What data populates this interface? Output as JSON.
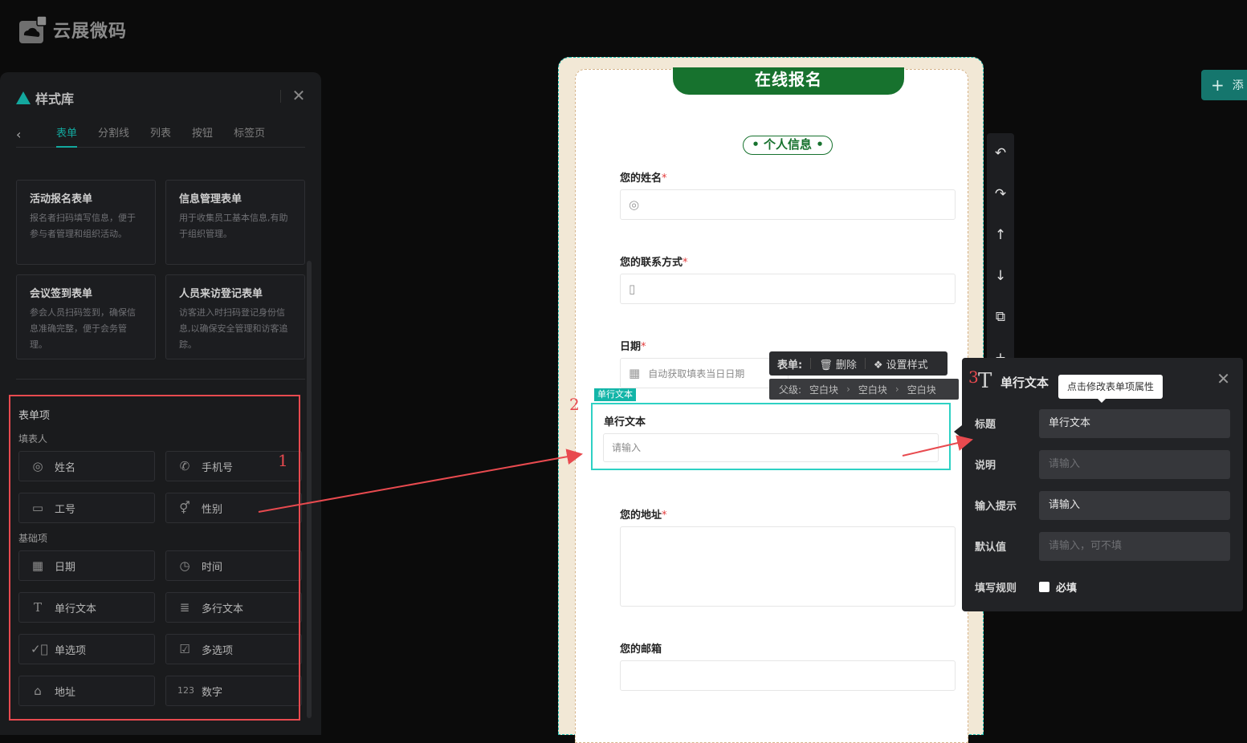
{
  "app": {
    "brand": "云展微码"
  },
  "style_panel": {
    "title": "样式库",
    "tabs": [
      {
        "label": "表单",
        "active": true
      },
      {
        "label": "分割线"
      },
      {
        "label": "列表"
      },
      {
        "label": "按钮"
      },
      {
        "label": "标签页"
      }
    ],
    "templates": [
      {
        "title": "活动报名表单",
        "desc": "报名者扫码填写信息，便于参与者管理和组织活动。"
      },
      {
        "title": "信息管理表单",
        "desc": "用于收集员工基本信息,有助于组织管理。"
      },
      {
        "title": "会议签到表单",
        "desc": "参会人员扫码签到，确保信息准确完整，便于会务管理。"
      },
      {
        "title": "人员来访登记表单",
        "desc": "访客进入时扫码登记身份信息,以确保安全管理和访客追踪。"
      }
    ],
    "section_form_items": "表单项",
    "group_filler": "填表人",
    "group_basic": "基础项",
    "items": [
      {
        "label": "姓名",
        "icon": "person-circle-icon"
      },
      {
        "label": "手机号",
        "icon": "phone-icon"
      },
      {
        "label": "工号",
        "icon": "id-card-icon"
      },
      {
        "label": "性别",
        "icon": "gender-icon"
      },
      {
        "label": "日期",
        "icon": "calendar-icon"
      },
      {
        "label": "时间",
        "icon": "clock-icon"
      },
      {
        "label": "单行文本",
        "icon": "text-t-icon"
      },
      {
        "label": "多行文本",
        "icon": "multiline-text-icon"
      },
      {
        "label": "单选项",
        "icon": "radio-check-icon"
      },
      {
        "label": "多选项",
        "icon": "checkbox-icon"
      },
      {
        "label": "地址",
        "icon": "building-icon"
      },
      {
        "label": "数字",
        "icon": "number-icon"
      }
    ]
  },
  "annotations": {
    "n1": "1",
    "n2": "2",
    "n3": "3"
  },
  "canvas": {
    "banner": "在线报名",
    "section": "• 个人信息 •",
    "fields": {
      "name_label": "您的姓名",
      "contact_label": "您的联系方式",
      "date_label": "日期",
      "date_placeholder": "自动获取填表当日日期",
      "single_text_label": "单行文本",
      "single_text_placeholder": "请输入",
      "address_label": "您的地址",
      "email_label": "您的邮箱",
      "required_star": "*"
    },
    "selected_tag": "单行文本"
  },
  "toolbar": {
    "form_label": "表单:",
    "delete_label": "删除",
    "style_label": "设置样式",
    "parent_label": "父级:",
    "crumbs": [
      "空白块",
      "空白块",
      "空白块"
    ]
  },
  "side_tools": [
    "undo-icon",
    "redo-icon",
    "move-up-icon",
    "move-down-icon",
    "copy-icon",
    "add-icon"
  ],
  "add_button": {
    "label": "添"
  },
  "property_panel": {
    "title": "单行文本",
    "tooltip": "点击修改表单项属性",
    "rows": [
      {
        "label": "标题",
        "value": "单行文本",
        "placeholder": false
      },
      {
        "label": "说明",
        "value": "请输入",
        "placeholder": true
      },
      {
        "label": "输入提示",
        "value": "请输入",
        "placeholder": false
      },
      {
        "label": "默认值",
        "value": "请输入，可不填",
        "placeholder": true
      }
    ],
    "rule_label": "填写规则",
    "required_label": "必填"
  },
  "colors": {
    "accent": "#13a89e",
    "banner_green": "#17722e",
    "annotation_red": "#e84a4f"
  }
}
